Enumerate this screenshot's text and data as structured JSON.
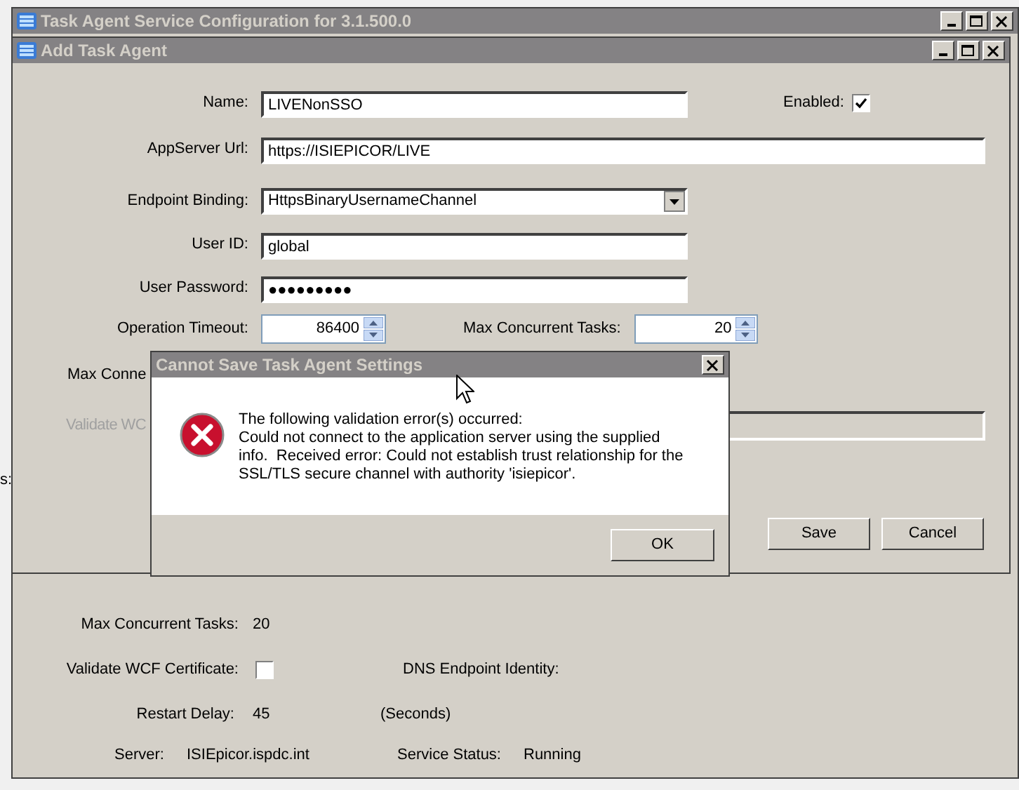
{
  "background_text": "s:",
  "main_window": {
    "title": "Task Agent Service Configuration for 3.1.500.0",
    "max_concurrent_tasks": {
      "label": "Max Concurrent Tasks:",
      "value": "20"
    },
    "validate_wcf_certificate": {
      "label": "Validate WCF Certificate:",
      "checked": false
    },
    "dns_endpoint_identity": {
      "label": "DNS Endpoint Identity:"
    },
    "restart_delay": {
      "label": "Restart Delay:",
      "value": "45",
      "unit": "(Seconds)"
    },
    "server": {
      "label": "Server:",
      "value": "ISIEpicor.ispdc.int"
    },
    "service_status": {
      "label": "Service Status:",
      "value": "Running"
    }
  },
  "add_task_window": {
    "title": "Add Task Agent",
    "name": {
      "label": "Name:",
      "value": "LIVENonSSO"
    },
    "enabled": {
      "label": "Enabled:",
      "checked": true
    },
    "appserver_url": {
      "label": "AppServer Url:",
      "value": "https://ISIEPICOR/LIVE"
    },
    "endpoint_binding": {
      "label": "Endpoint Binding:",
      "value": "HttpsBinaryUsernameChannel"
    },
    "user_id": {
      "label": "User ID:",
      "value": "global"
    },
    "user_password": {
      "label": "User Password:",
      "value": "●●●●●●●●●"
    },
    "operation_timeout": {
      "label": "Operation Timeout:",
      "value": "86400"
    },
    "max_concurrent_tasks": {
      "label": "Max Concurrent Tasks:",
      "value": "20"
    },
    "max_connection_label": {
      "text": "Max Conne"
    },
    "validate_wcf_label": {
      "text": "Validate WC",
      "disabled": true
    },
    "buttons": [
      "Save",
      "Cancel"
    ]
  },
  "dialog": {
    "title": "Cannot Save Task Agent Settings",
    "heading": "The following validation error(s) occurred:",
    "message_lines": [
      "Could not connect to the application server using the supplied",
      "info.  Received error: Could not establish trust relationship for the",
      "SSL/TLS secure channel with authority 'isiepicor'."
    ],
    "buttons": [
      "OK"
    ]
  }
}
